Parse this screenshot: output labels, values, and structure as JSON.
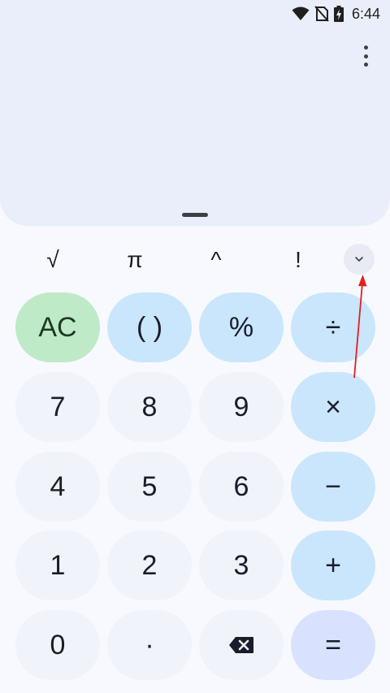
{
  "status_bar": {
    "time": "6:44",
    "icons": [
      "wifi-icon",
      "no-sim-icon",
      "battery-charging-icon"
    ]
  },
  "display": {
    "expression": "",
    "result": ""
  },
  "scientific_row": {
    "keys": [
      {
        "name": "sqrt",
        "label": "√"
      },
      {
        "name": "pi",
        "label": "π"
      },
      {
        "name": "power",
        "label": "^"
      },
      {
        "name": "factorial",
        "label": "!"
      }
    ],
    "expand_icon": "chevron-down-icon"
  },
  "keypad": {
    "row1": [
      {
        "name": "ac",
        "label": "AC"
      },
      {
        "name": "parentheses",
        "label": "( )"
      },
      {
        "name": "percent",
        "label": "%"
      },
      {
        "name": "divide",
        "label": "÷"
      }
    ],
    "row2": [
      {
        "name": "7",
        "label": "7"
      },
      {
        "name": "8",
        "label": "8"
      },
      {
        "name": "9",
        "label": "9"
      },
      {
        "name": "multiply",
        "label": "×"
      }
    ],
    "row3": [
      {
        "name": "4",
        "label": "4"
      },
      {
        "name": "5",
        "label": "5"
      },
      {
        "name": "6",
        "label": "6"
      },
      {
        "name": "minus",
        "label": "−"
      }
    ],
    "row4": [
      {
        "name": "1",
        "label": "1"
      },
      {
        "name": "2",
        "label": "2"
      },
      {
        "name": "3",
        "label": "3"
      },
      {
        "name": "plus",
        "label": "+"
      }
    ],
    "row5": [
      {
        "name": "0",
        "label": "0"
      },
      {
        "name": "decimal",
        "label": "·"
      },
      {
        "name": "backspace",
        "label": ""
      },
      {
        "name": "equals",
        "label": "="
      }
    ]
  },
  "colors": {
    "display_bg": "#e9eefa",
    "number_key": "#f1f3fa",
    "operator_key": "#c9e6fc",
    "clear_key": "#bfeac8",
    "equals_key": "#d8e2ff",
    "annotation_arrow": "#e02020"
  }
}
